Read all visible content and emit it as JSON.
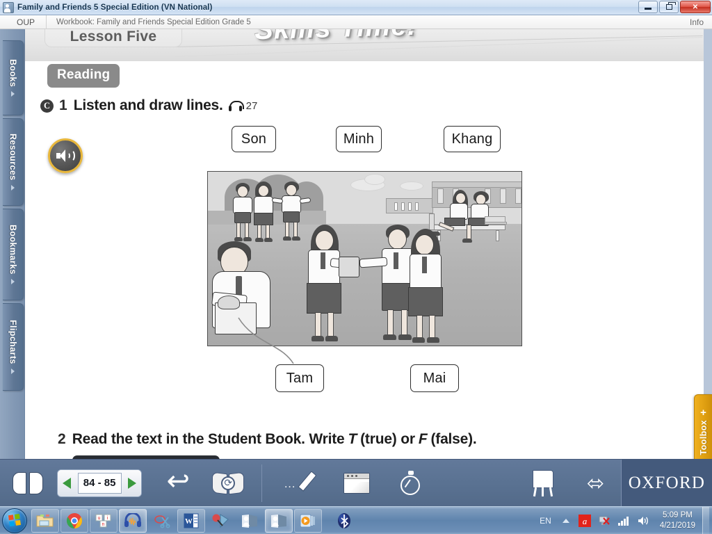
{
  "window": {
    "title": "Family and Friends 5 Special Edition (VN National)",
    "icon": "app-window-icon",
    "minimize_label": "Minimize",
    "restore_label": "Restore",
    "close_label": "Close"
  },
  "appbar": {
    "brand": "OUP",
    "document": "Workbook: Family and Friends Special Edition Grade 5",
    "info": "Info"
  },
  "rail": {
    "items": [
      {
        "label": "Books",
        "arrow": "triangle-right-icon"
      },
      {
        "label": "Resources",
        "arrow": "triangle-right-icon"
      },
      {
        "label": "Bookmarks",
        "arrow": "triangle-right-icon"
      },
      {
        "label": "Flipcharts",
        "arrow": "triangle-right-icon"
      }
    ]
  },
  "page": {
    "lesson_tab": "Lesson Five",
    "banner_title": "Skills Time!",
    "section_badge": "Reading",
    "exercise1": {
      "marker": "C",
      "number": "1",
      "instruction": "Listen and draw lines.",
      "audio_icon": "headphones-icon",
      "track": "27",
      "speaker_button": "play-audio-icon",
      "name_boxes_top": [
        "Son",
        "Minh",
        "Khang"
      ],
      "name_boxes_bottom": [
        "Tam",
        "Mai"
      ],
      "illustration_alt": "Grayscale illustration of schoolchildren in a schoolyard sharing food, with a boy holding a bag at the left and students on a bench at the right",
      "drawn_answer_line": "Tam"
    },
    "exercise2": {
      "number": "2",
      "instruction_part1": "Read the text in the Student Book. Write",
      "true_letter": "T",
      "true_word": "(true) or",
      "false_letter": "F",
      "false_word": "(false)."
    }
  },
  "toolbox": {
    "label": "Toolbox",
    "plus": "+"
  },
  "toolbar": {
    "contents_icon": "open-book-icon",
    "prev_label": "Previous page",
    "page_range": "84 - 85",
    "next_label": "Next page",
    "undo_icon": "undo-arrow-icon",
    "flip_icon": "flip-page-icon",
    "pencil_icon": "pen-tool-icon",
    "window_icon": "window-tool-icon",
    "timer_icon": "stopwatch-icon",
    "easel_icon": "flipchart-easel-icon",
    "swap_icon": "double-arrow-icon",
    "brand": "OXFORD"
  },
  "taskbar": {
    "start": "start-orb-icon",
    "items": [
      {
        "name": "file-explorer",
        "state": "pinned"
      },
      {
        "name": "google-chrome",
        "state": "pinned"
      },
      {
        "name": "unikey",
        "state": "pinned"
      },
      {
        "name": "audacity",
        "state": "active"
      },
      {
        "name": "snipping-tool",
        "state": "pinned"
      },
      {
        "name": "microsoft-word",
        "state": "pinned"
      },
      {
        "name": "paint-tool",
        "state": "pinned"
      },
      {
        "name": "oxford-reader-1",
        "state": "pinned"
      },
      {
        "name": "oxford-reader-2",
        "state": "active"
      },
      {
        "name": "media-player",
        "state": "pinned"
      },
      {
        "name": "bluetooth",
        "state": "tray"
      }
    ],
    "tray": {
      "language": "EN",
      "show_hidden_icon": "chevron-up-icon",
      "antivirus_icon": "avira-shield-icon",
      "network_icon": "network-error-icon",
      "signal_icon": "signal-bars-icon",
      "volume_icon": "speaker-icon",
      "time": "5:09 PM",
      "date": "4/21/2019"
    }
  },
  "colors": {
    "titlebar": "#cfe0f2",
    "rail": "#8298b4",
    "toolbar": "#5a7292",
    "oxford_block": "#445a7c",
    "toolbox_accent": "#e0a012",
    "badge_gray": "#8a8a8a",
    "nav_arrow_green": "#3a9a3e",
    "taskbar": "#5f84ad"
  }
}
